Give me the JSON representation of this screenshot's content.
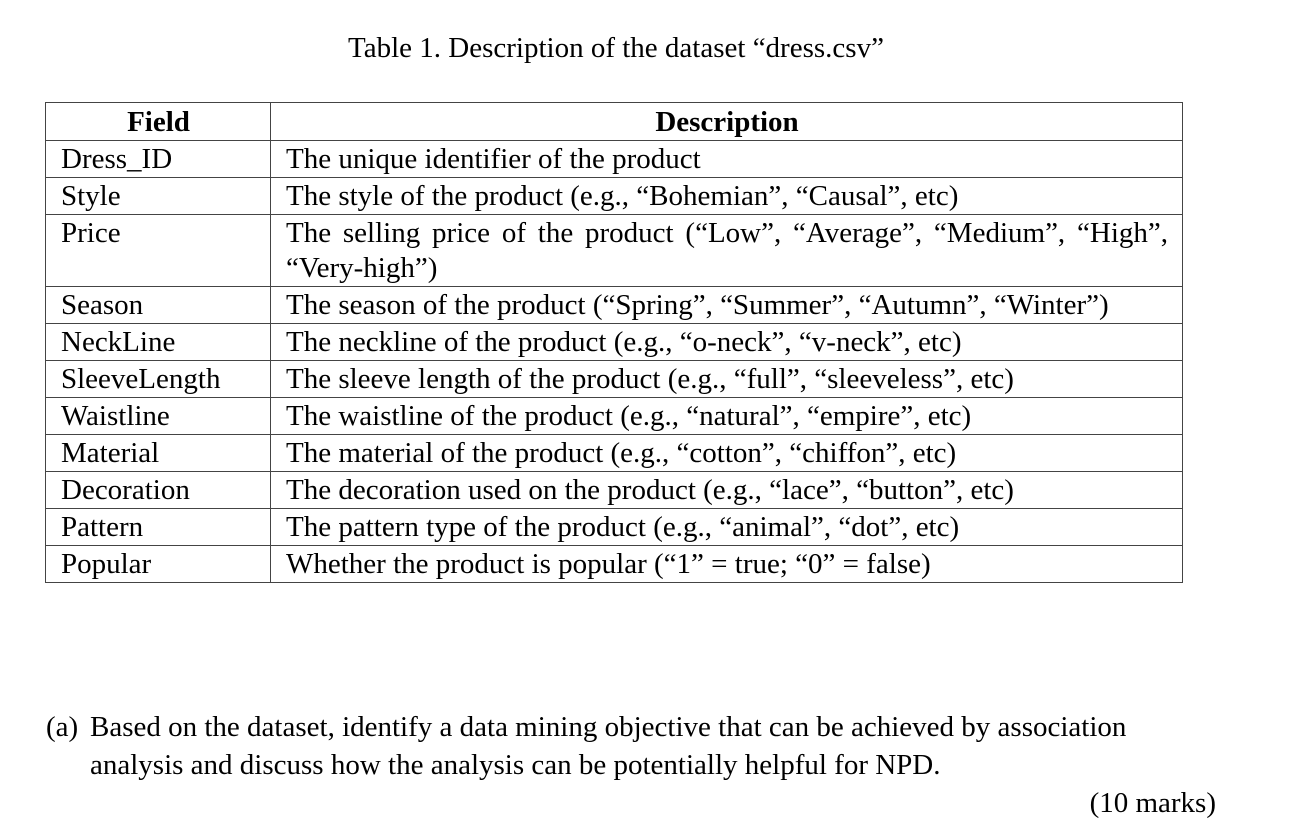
{
  "caption": "Table 1. Description of the dataset “dress.csv”",
  "table": {
    "headers": [
      "Field",
      "Description"
    ],
    "rows": [
      {
        "field": "Dress_ID",
        "description": "The unique identifier of the product"
      },
      {
        "field": "Style",
        "description": "The style of the product (e.g., “Bohemian”, “Causal”, etc)"
      },
      {
        "field": "Price",
        "description": "The selling price of the product (“Low”, “Average”, “Medium”, “High”, “Very-high”)"
      },
      {
        "field": "Season",
        "description": "The season of the product (“Spring”, “Summer”, “Autumn”, “Winter”)"
      },
      {
        "field": "NeckLine",
        "description": "The neckline of the product (e.g., “o-neck”, “v-neck”, etc)"
      },
      {
        "field": "SleeveLength",
        "description": "The sleeve length of the product (e.g., “full”, “sleeveless”, etc)"
      },
      {
        "field": "Waistline",
        "description": "The waistline of the product (e.g., “natural”, “empire”, etc)"
      },
      {
        "field": "Material",
        "description": "The material of the product (e.g., “cotton”, “chiffon”, etc)"
      },
      {
        "field": "Decoration",
        "description": "The decoration used on the product (e.g., “lace”, “button”, etc)"
      },
      {
        "field": "Pattern",
        "description": "The pattern type of the product (e.g., “animal”, “dot”, etc)"
      },
      {
        "field": "Popular",
        "description": "Whether the product is popular (“1” = true; “0” = false)"
      }
    ]
  },
  "question": {
    "label": "(a)",
    "text": "Based on the dataset, identify a data mining objective that can be achieved by association analysis and discuss how the analysis can be potentially helpful for NPD.",
    "marks": "(10 marks)"
  }
}
